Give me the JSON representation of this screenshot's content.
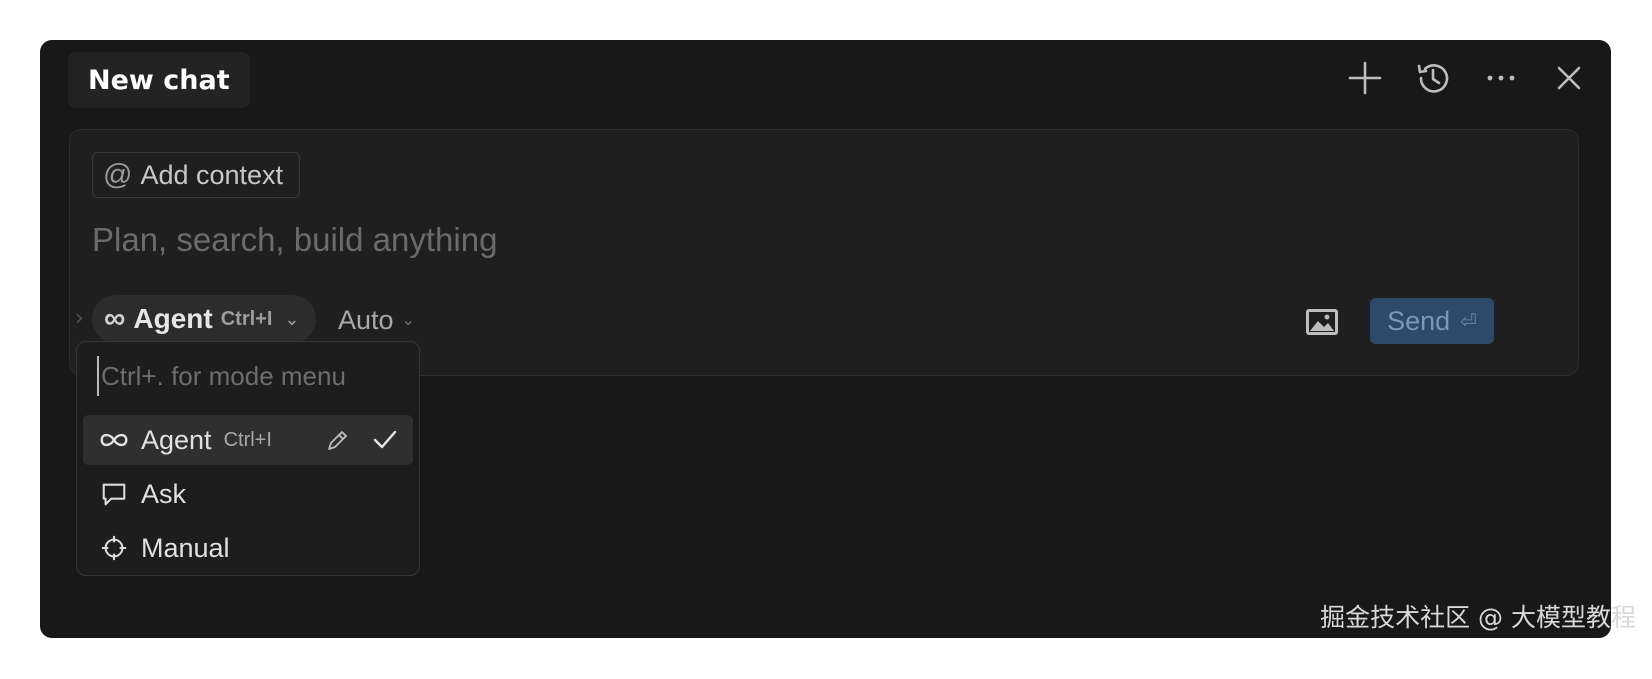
{
  "header": {
    "tab_title": "New chat",
    "actions": [
      {
        "icon": "plus-icon"
      },
      {
        "icon": "history-icon"
      },
      {
        "icon": "more-icon"
      },
      {
        "icon": "close-icon"
      }
    ]
  },
  "composer": {
    "add_context_label": "Add context",
    "add_context_icon": "@",
    "prompt_placeholder": "Plan, search, build anything",
    "mode_icon": "∞",
    "mode_label": "Agent",
    "mode_shortcut": "Ctrl+I",
    "model_label": "Auto",
    "send_label": "Send",
    "send_enter_glyph": "⏎",
    "image_icon": "image-icon"
  },
  "mode_menu": {
    "search_placeholder": "Ctrl+. for mode menu",
    "items": [
      {
        "label": "Agent",
        "shortcut": "Ctrl+I",
        "icon": "infinity-icon",
        "selected": true
      },
      {
        "label": "Ask",
        "icon": "chat-bubble-icon"
      },
      {
        "label": "Manual",
        "icon": "crosshair-icon"
      }
    ]
  },
  "watermark": "掘金技术社区 @ 大模型教程",
  "colors": {
    "window_bg": "#181818",
    "composer_bg": "#1f1f1f",
    "send_bg": "#2e4a6b",
    "menu_active_bg": "#2f2f2f"
  }
}
